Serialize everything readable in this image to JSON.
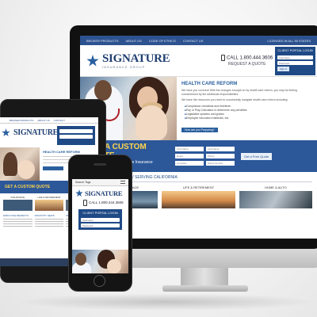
{
  "brand": {
    "name": "SIGNATURE",
    "tagline": "INSURANCE GROUP",
    "primary_color": "#2c5799",
    "accent_color": "#ffd54a"
  },
  "desktop": {
    "nav": [
      "BROKER PRODUCTS",
      "ABOUT US",
      "CODE OF ETHICS",
      "CONTACT US"
    ],
    "login_text": "LICENSED IN ALL 50 STATES",
    "phone": "CALL 1.800.444.3606",
    "request_quote": "REQUEST A QUOTE",
    "portal": {
      "title": "CLIENT PORTAL LOGIN",
      "username": "Username",
      "password": "Password",
      "button": "Sign in"
    },
    "hero": {
      "title": "HEALTH CARE REFORM",
      "p1": "We have you covered! With the changes brought on by health care reform, you may be feeling overwhelmed by the additional responsibilities.",
      "p2": "We have the resources you need to successfully navigate health care reform including:",
      "bullets": [
        "Compliance checklists and timelines",
        "Pay or Play Calculator to determine any penalties",
        "Legislative updates and guides",
        "Employee education materials, etc."
      ],
      "cta": "How are you Preparing?"
    },
    "quote": {
      "title": "GET A CUSTOM QUOTE",
      "subtitle_1": "and speak with a Signature Insurance",
      "subtitle_2": "Professional Today.",
      "fields": [
        "First Name",
        "Last Name",
        "Email",
        "Phone",
        "Company",
        "Select Service"
      ],
      "button": "Get a Free Quote"
    },
    "services": {
      "heading": "INSURANCE PRODUCTS / SERVING CALIFORNIA",
      "cards": [
        "BUSINESS COVERAGE",
        "LIFE & RETIREMENT",
        "HOME & AUTO"
      ]
    }
  },
  "tablet": {
    "nav": [
      "BROKER PRODUCTS",
      "ABOUT US",
      "CONTACT"
    ],
    "hero_title": "HEALTH CARE REFORM",
    "quote_title": "GET A CUSTOM QUOTE",
    "services": [
      "INSURANCE",
      "LIFE & RETIREMENT",
      "HOME & AUTO"
    ],
    "news": [
      "EMPLOYEE BENEFITS",
      "INDUSTRY NEWS",
      "RESOURCES"
    ]
  },
  "mobile": {
    "nav_title": "Search Tags",
    "phone": "CALL 1.800.444.3606",
    "portal_title": "CLIENT PORTAL LOGIN",
    "username": "Username",
    "password": "Password",
    "button": "Sign in"
  }
}
